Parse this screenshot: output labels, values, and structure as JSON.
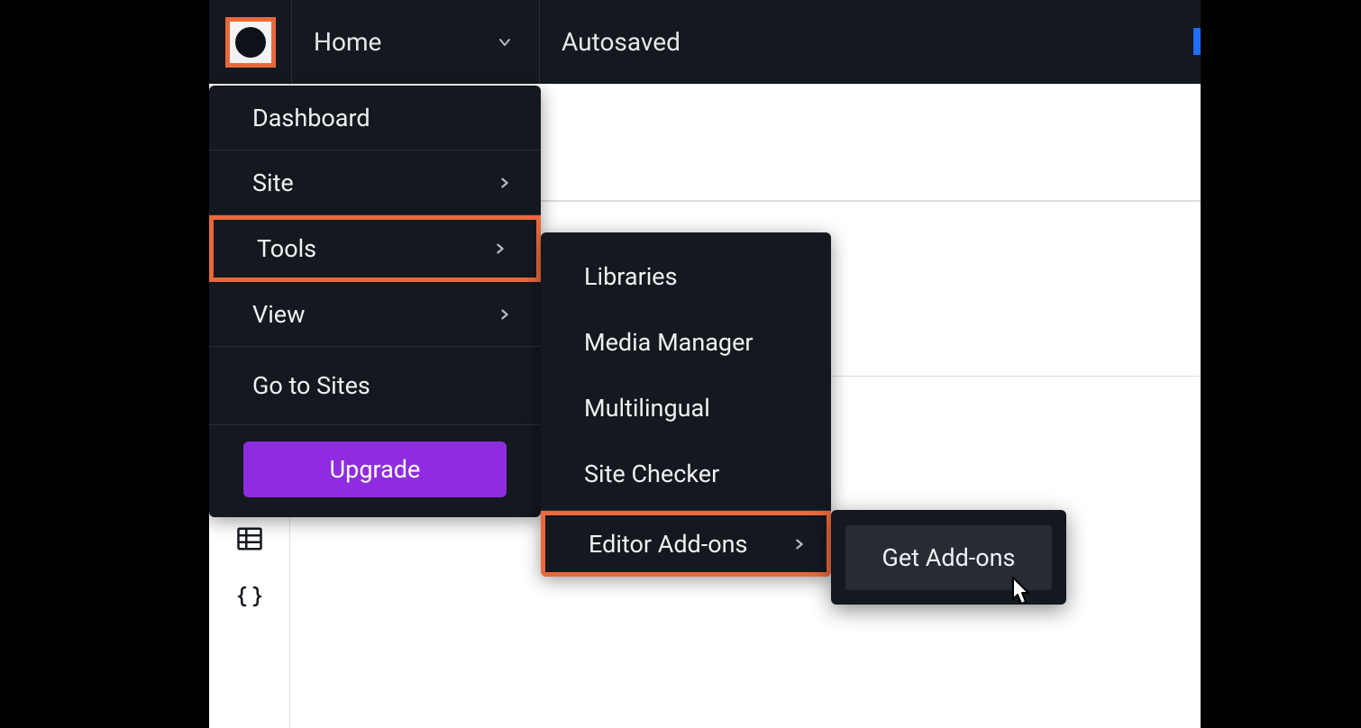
{
  "topbar": {
    "page_label": "Home",
    "save_status": "Autosaved"
  },
  "main_menu": {
    "dashboard": "Dashboard",
    "site": "Site",
    "tools": "Tools",
    "view": "View",
    "go_to_sites": "Go to Sites",
    "upgrade": "Upgrade"
  },
  "tools_menu": {
    "libraries": "Libraries",
    "media_manager": "Media Manager",
    "multilingual": "Multilingual",
    "site_checker": "Site Checker",
    "editor_addons": "Editor Add-ons"
  },
  "addons_menu": {
    "get_addons": "Get Add-ons"
  },
  "colors": {
    "highlight": "#e8693c",
    "accent": "#8f2ce0",
    "panel": "#14181f"
  }
}
